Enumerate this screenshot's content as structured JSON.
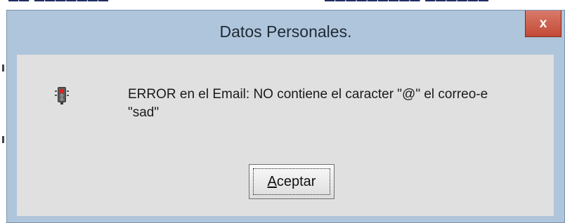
{
  "dialog": {
    "title": "Datos Personales.",
    "close_glyph": "x",
    "icon": "traffic-light-stop-icon",
    "message": "ERROR en el  Email: NO contiene el caracter \"@\" el correo-e \"sad\"",
    "ok_button": {
      "mnemonic": "A",
      "rest": "ceptar"
    }
  },
  "colors": {
    "frame": "#afc5db",
    "client": "#e0e0e0",
    "close_button": "#c7503d"
  }
}
